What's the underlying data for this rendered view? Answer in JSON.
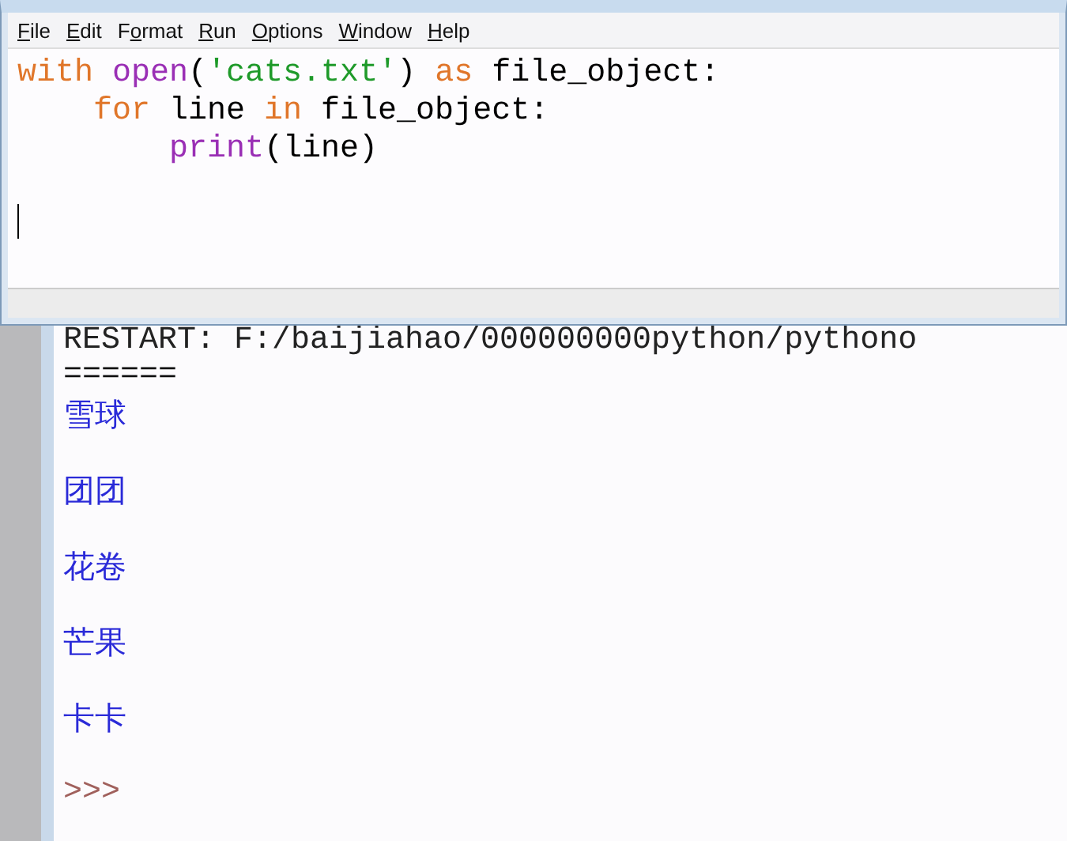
{
  "editor": {
    "menu": [
      {
        "segments": [
          {
            "text": "F",
            "underlined": true
          },
          {
            "text": "ile",
            "underlined": false
          }
        ]
      },
      {
        "segments": [
          {
            "text": "E",
            "underlined": true
          },
          {
            "text": "dit",
            "underlined": false
          }
        ]
      },
      {
        "segments": [
          {
            "text": "F",
            "underlined": false
          },
          {
            "text": "o",
            "underlined": true
          },
          {
            "text": "rmat",
            "underlined": false
          }
        ]
      },
      {
        "segments": [
          {
            "text": "R",
            "underlined": true
          },
          {
            "text": "un",
            "underlined": false
          }
        ]
      },
      {
        "segments": [
          {
            "text": "O",
            "underlined": true
          },
          {
            "text": "ptions",
            "underlined": false
          }
        ]
      },
      {
        "segments": [
          {
            "text": "W",
            "underlined": true
          },
          {
            "text": "indow",
            "underlined": false
          }
        ]
      },
      {
        "segments": [
          {
            "text": "H",
            "underlined": true
          },
          {
            "text": "elp",
            "underlined": false
          }
        ]
      }
    ],
    "code": [
      [
        {
          "kind": "keyword",
          "text": "with"
        },
        {
          "kind": "builtin",
          "text": " open"
        },
        {
          "kind": "plain",
          "text": "("
        },
        {
          "kind": "string",
          "text": "'cats.txt'"
        },
        {
          "kind": "plain",
          "text": ") "
        },
        {
          "kind": "keyword",
          "text": "as"
        },
        {
          "kind": "plain",
          "text": " file_object:"
        }
      ],
      [
        {
          "kind": "keyword",
          "text": "    for"
        },
        {
          "kind": "plain",
          "text": " line "
        },
        {
          "kind": "keyword",
          "text": "in"
        },
        {
          "kind": "plain",
          "text": " file_object:"
        }
      ],
      [
        {
          "kind": "builtin",
          "text": "        print"
        },
        {
          "kind": "plain",
          "text": "(line)"
        }
      ]
    ]
  },
  "shell": {
    "lines": [
      {
        "kind": "restart",
        "text": "RESTART: F:/baijiahao/000000000python/pythono"
      },
      {
        "kind": "separator",
        "text": "======"
      },
      {
        "kind": "output",
        "text": "雪球"
      },
      {
        "kind": "output",
        "text": "团团"
      },
      {
        "kind": "output",
        "text": "花卷"
      },
      {
        "kind": "output",
        "text": "芒果"
      },
      {
        "kind": "output",
        "text": "卡卡"
      },
      {
        "kind": "prompt",
        "text": ">>>"
      }
    ]
  }
}
